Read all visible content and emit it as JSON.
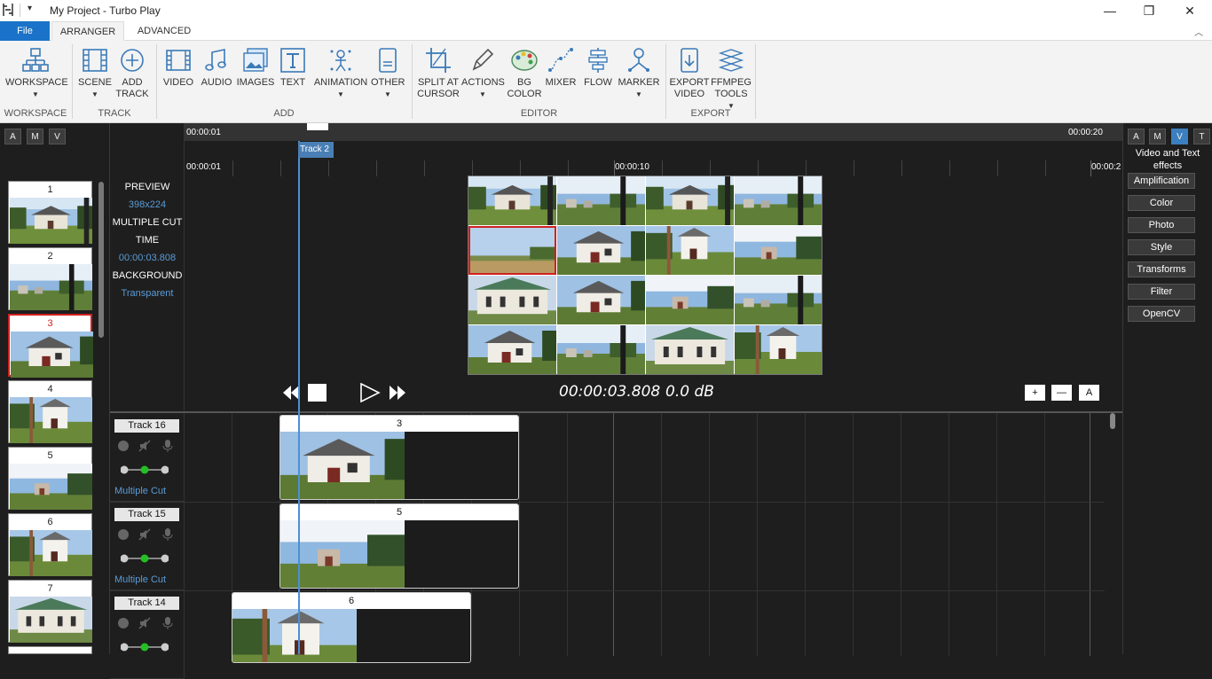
{
  "window": {
    "title": "My Project - Turbo Play",
    "minimize": "—",
    "maximize": "❐",
    "close": "✕"
  },
  "tabs": [
    "File",
    "ARRANGER",
    "ADVANCED"
  ],
  "ribbon": {
    "buttons": {
      "workspace": "WORKSPACE",
      "scene": "SCENE",
      "add_track_1": "ADD",
      "add_track_2": "TRACK",
      "video": "VIDEO",
      "audio": "AUDIO",
      "images": "IMAGES",
      "text": "TEXT",
      "animation": "ANIMATION",
      "other": "OTHER",
      "split_1": "SPLIT AT",
      "split_2": "CURSOR",
      "actions": "ACTIONS",
      "bg_1": "BG",
      "bg_2": "COLOR",
      "mixer": "MIXER",
      "flow": "FLOW",
      "marker": "MARKER",
      "export_1": "EXPORT",
      "export_2": "VIDEO",
      "ffmpeg_1": "FFMPEG",
      "ffmpeg_2": "TOOLS"
    },
    "groups": {
      "workspace": "WORKSPACE",
      "track": "TRACK",
      "add": "ADD",
      "editor": "EDITOR",
      "export": "EXPORT"
    }
  },
  "left_panel": {
    "modes": [
      "A",
      "M",
      "V"
    ],
    "scenes": [
      "1",
      "2",
      "3",
      "4",
      "5",
      "6",
      "7"
    ],
    "selected_scene": "3"
  },
  "preview_info": {
    "preview_label": "PREVIEW",
    "resolution": "398x224",
    "mode": "MULTIPLE CUT",
    "time_label": "TIME",
    "time_value": "00:00:03.808",
    "background_label": "BACKGROUND",
    "background_value": "Transparent"
  },
  "ruler": {
    "top_start": "00:00:01",
    "top_end": "00:00:20",
    "start": "00:00:01",
    "mid": "00:00:10",
    "end": "00:00:2",
    "cursor_track": "Track 2"
  },
  "transport": {
    "timecode": "00:00:03.808",
    "level": "0.0 dB",
    "zoom_in": "+",
    "zoom_out": "—",
    "auto": "A"
  },
  "tracks": [
    {
      "name": "Track 16",
      "mode": "Multiple Cut",
      "clip": "3"
    },
    {
      "name": "Track 15",
      "mode": "Multiple Cut",
      "clip": "5"
    },
    {
      "name": "Track 14",
      "mode": "",
      "clip": "6"
    }
  ],
  "right_panel": {
    "modes": [
      "A",
      "M",
      "V",
      "T"
    ],
    "title": "Video and Text effects",
    "effects": [
      "Amplification",
      "Color",
      "Photo",
      "Style",
      "Transforms",
      "Filter",
      "OpenCV"
    ]
  }
}
